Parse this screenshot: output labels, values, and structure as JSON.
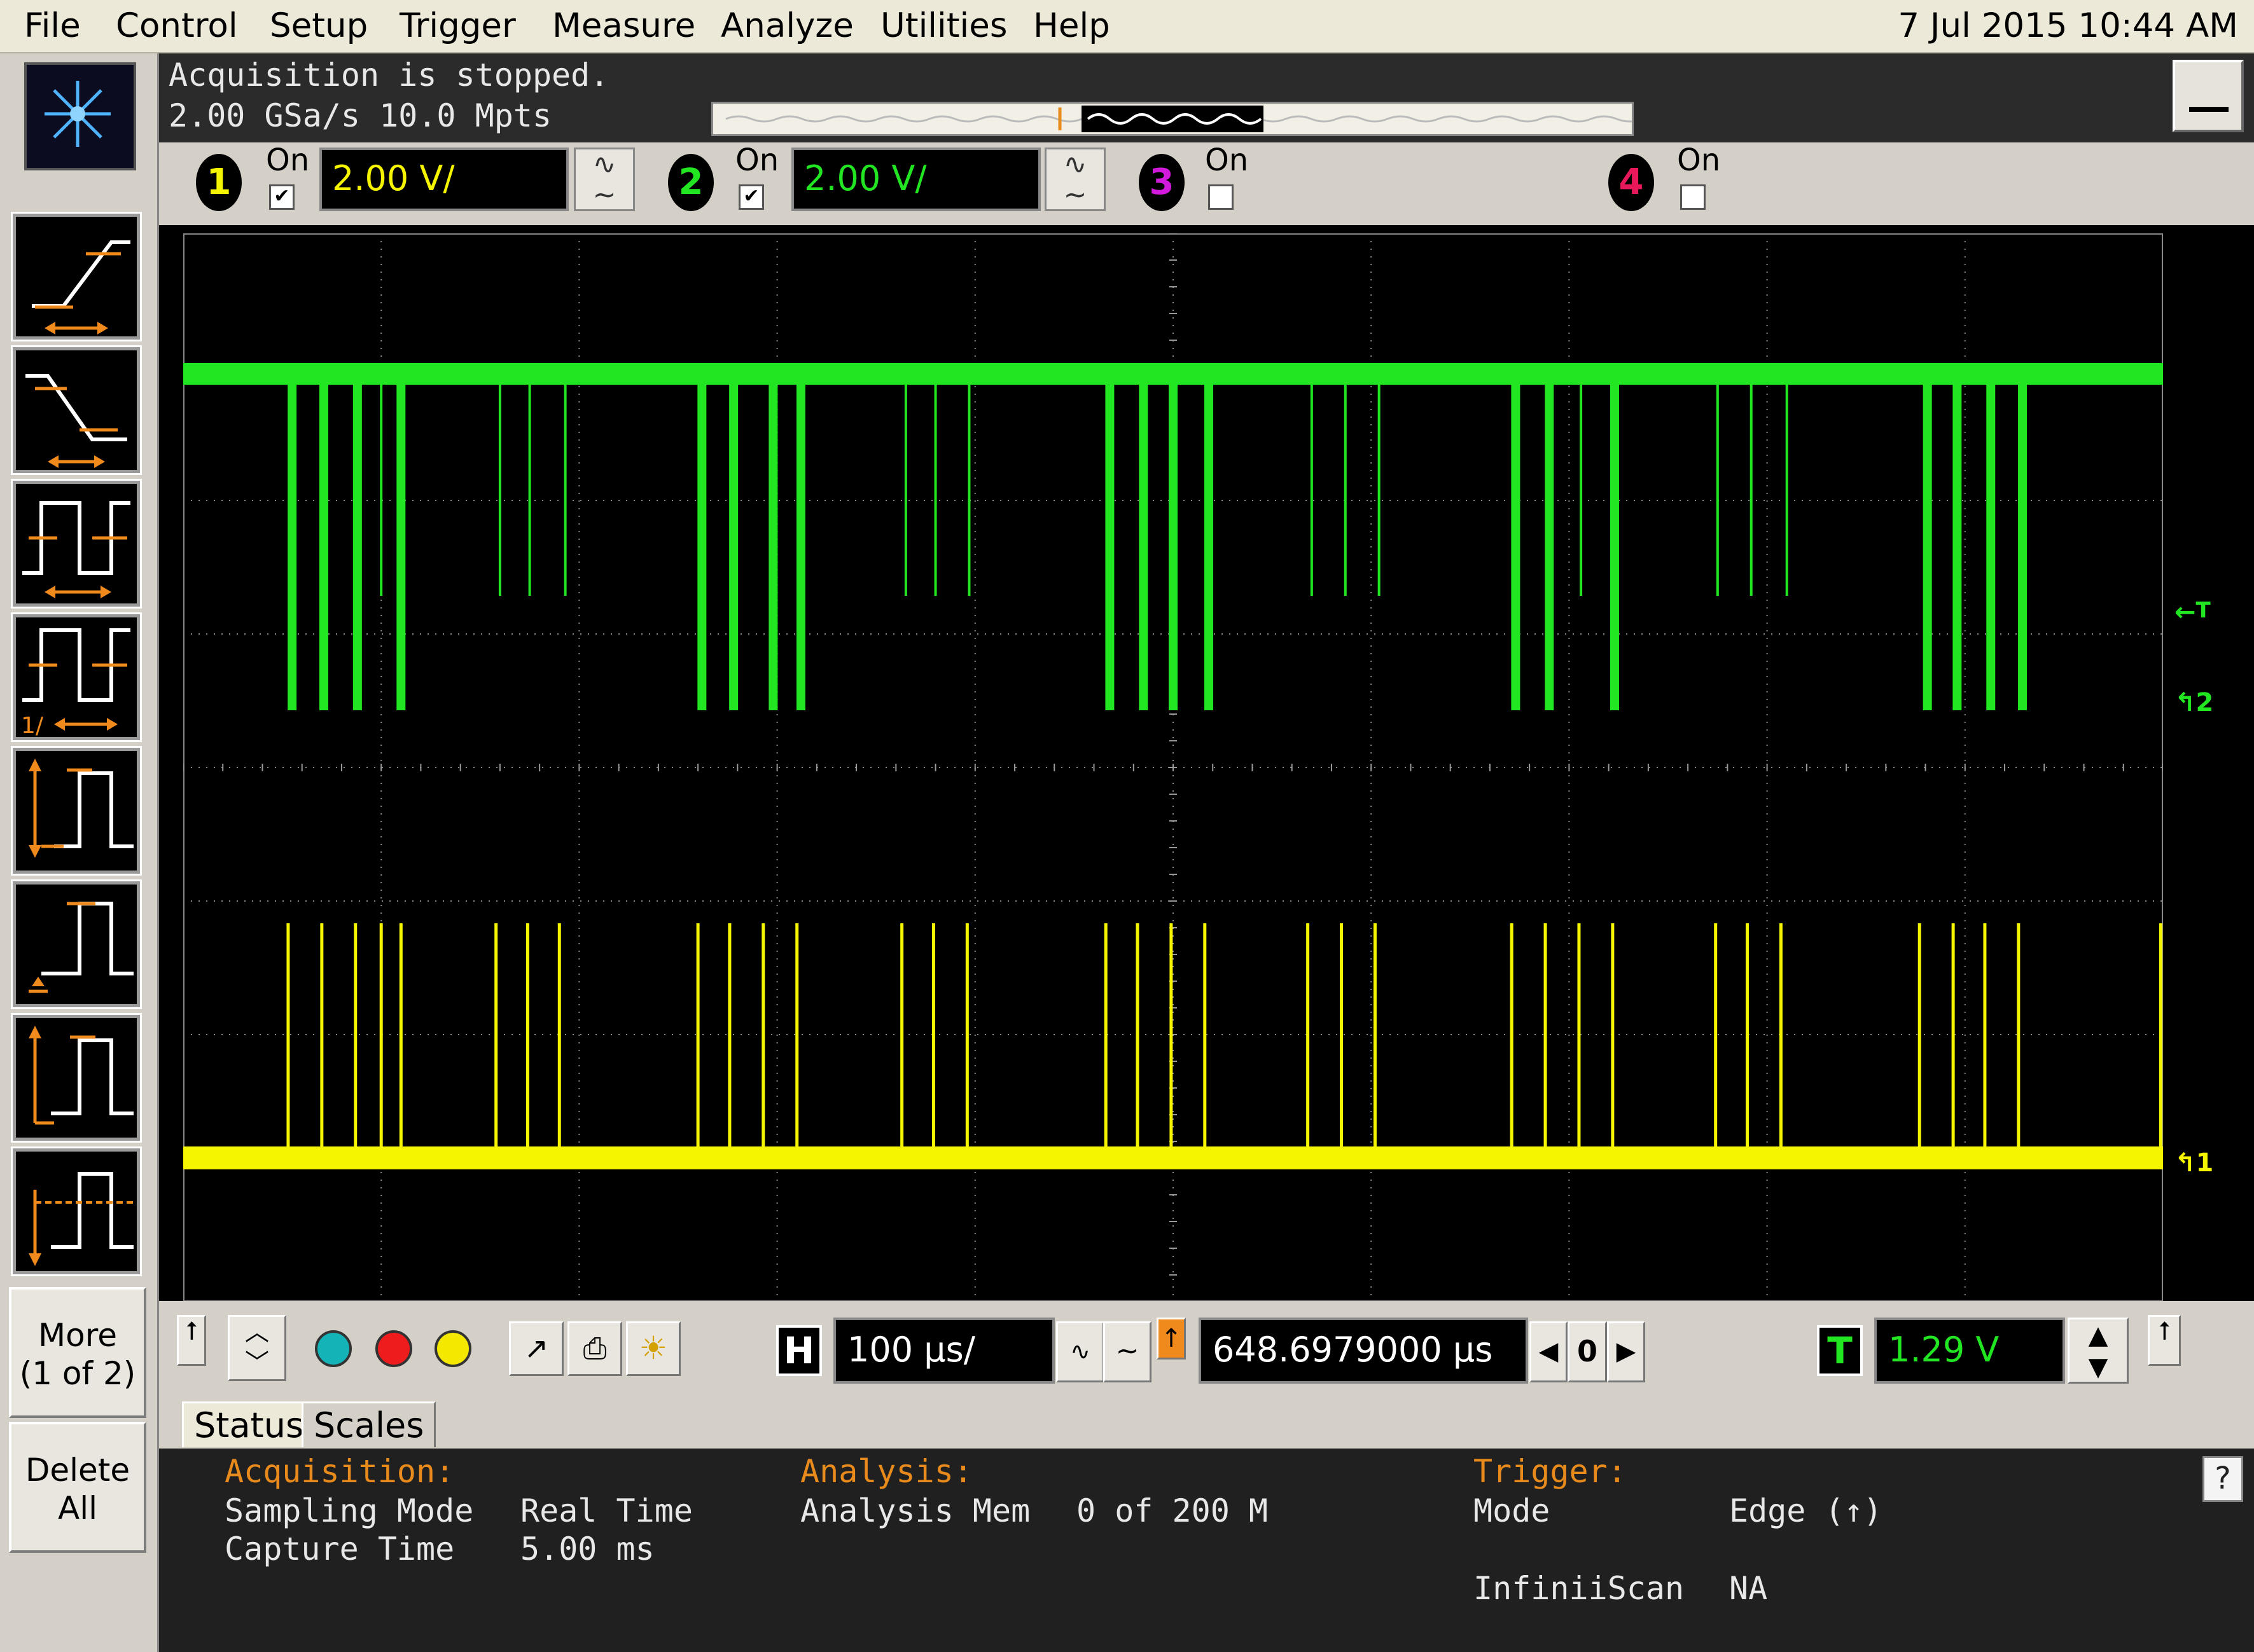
{
  "menu": {
    "items": [
      "File",
      "Control",
      "Setup",
      "Trigger",
      "Measure",
      "Analyze",
      "Utilities",
      "Help"
    ],
    "clock": "7 Jul 2015 10:44 AM"
  },
  "acquisition_bar": {
    "status": "Acquisition is stopped.",
    "rate_line": "2.00 GSa/s   10.0 Mpts"
  },
  "channels": [
    {
      "num": "1",
      "on_label": "On",
      "checked": true,
      "scale": "2.00 V/",
      "color": "#f5f500"
    },
    {
      "num": "2",
      "on_label": "On",
      "checked": true,
      "scale": "2.00 V/",
      "color": "#22e622"
    },
    {
      "num": "3",
      "on_label": "On",
      "checked": false,
      "scale": "",
      "color": "#d21adc"
    },
    {
      "num": "4",
      "on_label": "On",
      "checked": false,
      "scale": "",
      "color": "#e8195a"
    }
  ],
  "side": {
    "more_label": "More",
    "more_page": "(1 of 2)",
    "delete_label_1": "Delete",
    "delete_label_2": "All"
  },
  "display": {
    "trigger_marker_label": "T",
    "ch2_marker_label": "2",
    "ch1_marker_label": "1"
  },
  "controls": {
    "h_letter": "H",
    "timebase": "100 µs/",
    "delay": "648.6979000 µs",
    "delay_ref": "0",
    "t_letter": "T",
    "trigger_level": "1.29 V"
  },
  "tabs": [
    "Status",
    "Scales"
  ],
  "status": {
    "acquisition_header": "Acquisition:",
    "sampling_mode_label": "Sampling Mode",
    "sampling_mode_value": "Real Time",
    "capture_time_label": "Capture Time",
    "capture_time_value": "5.00 ms",
    "analysis_header": "Analysis:",
    "analysis_mem_label": "Analysis Mem",
    "analysis_mem_value": "0 of 200 M",
    "trigger_header": "Trigger:",
    "mode_label": "Mode",
    "mode_value": "Edge (↑)",
    "infiniiscan_label": "InfiniiScan",
    "infiniiscan_value": "NA"
  },
  "help_label": "?",
  "waveforms": {
    "ch2_color": "#22e622",
    "ch1_color": "#f5f500",
    "ch2_pulses": [
      {
        "x": 0.055,
        "deep": true
      },
      {
        "x": 0.071,
        "deep": true
      },
      {
        "x": 0.088,
        "deep": true
      },
      {
        "x": 0.1,
        "deep": false
      },
      {
        "x": 0.11,
        "deep": true
      },
      {
        "x": 0.16,
        "deep": false
      },
      {
        "x": 0.175,
        "deep": false
      },
      {
        "x": 0.193,
        "deep": false
      },
      {
        "x": 0.262,
        "deep": true
      },
      {
        "x": 0.278,
        "deep": true
      },
      {
        "x": 0.298,
        "deep": true
      },
      {
        "x": 0.312,
        "deep": false
      },
      {
        "x": 0.312,
        "deep": true
      },
      {
        "x": 0.365,
        "deep": false
      },
      {
        "x": 0.38,
        "deep": false
      },
      {
        "x": 0.397,
        "deep": false
      },
      {
        "x": 0.468,
        "deep": true
      },
      {
        "x": 0.485,
        "deep": true
      },
      {
        "x": 0.5,
        "deep": true
      },
      {
        "x": 0.518,
        "deep": true
      },
      {
        "x": 0.57,
        "deep": false
      },
      {
        "x": 0.587,
        "deep": false
      },
      {
        "x": 0.604,
        "deep": false
      },
      {
        "x": 0.673,
        "deep": true
      },
      {
        "x": 0.69,
        "deep": true
      },
      {
        "x": 0.706,
        "deep": false
      },
      {
        "x": 0.723,
        "deep": true
      },
      {
        "x": 0.775,
        "deep": false
      },
      {
        "x": 0.792,
        "deep": false
      },
      {
        "x": 0.81,
        "deep": false
      },
      {
        "x": 0.881,
        "deep": true
      },
      {
        "x": 0.896,
        "deep": true
      },
      {
        "x": 0.913,
        "deep": true
      },
      {
        "x": 0.929,
        "deep": true
      }
    ],
    "ch1_pulses": [
      0.053,
      0.07,
      0.087,
      0.1,
      0.11,
      0.158,
      0.174,
      0.19,
      0.26,
      0.276,
      0.293,
      0.31,
      0.363,
      0.379,
      0.396,
      0.466,
      0.482,
      0.499,
      0.516,
      0.568,
      0.585,
      0.602,
      0.671,
      0.688,
      0.705,
      0.722,
      0.774,
      0.79,
      0.807,
      0.877,
      0.894,
      0.91,
      0.927
    ]
  }
}
